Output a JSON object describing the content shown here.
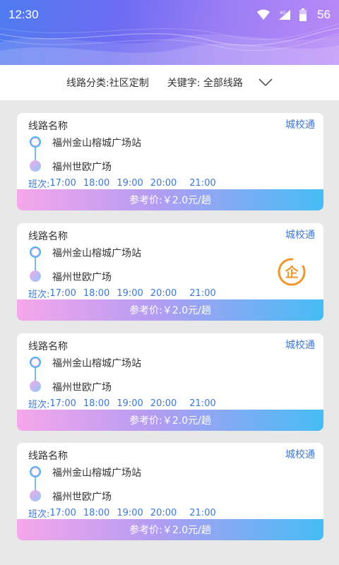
{
  "status_bar": {
    "time": "12:30",
    "battery": "56",
    "icons": [
      "wifi-icon",
      "signal-4g-icon",
      "battery-icon"
    ]
  },
  "filter": {
    "category_label": "线路分类:社区定制",
    "keyword_label": "关键字: 全部线路",
    "dropdown_icon": "chevron-down-icon"
  },
  "colors": {
    "accent_blue": "#3c78d8",
    "badge_orange": "#f0962a",
    "price_gradient_start": "#f6a7ea",
    "price_gradient_end": "#45bdf5"
  },
  "routes": [
    {
      "name": "线路名称",
      "tag": "城校通",
      "start": "福州金山榕城广场站",
      "end": "福州世欧广场",
      "schedule_label": "班次:",
      "times": [
        "17:00",
        "18:00",
        "19:00",
        "20:00",
        "21:00"
      ],
      "price": "参考价:￥2.0元/趟",
      "enterprise": false
    },
    {
      "name": "线路名称",
      "tag": "城校通",
      "start": "福州金山榕城广场站",
      "end": "福州世欧广场",
      "schedule_label": "班次:",
      "times": [
        "17:00",
        "18:00",
        "19:00",
        "20:00",
        "21:00"
      ],
      "price": "参考价:￥2.0元/趟",
      "enterprise": true,
      "enterprise_label": "企"
    },
    {
      "name": "线路名称",
      "tag": "城校通",
      "start": "福州金山榕城广场站",
      "end": "福州世欧广场",
      "schedule_label": "班次:",
      "times": [
        "17:00",
        "18:00",
        "19:00",
        "20:00",
        "21:00"
      ],
      "price": "参考价:￥2.0元/趟",
      "enterprise": false
    },
    {
      "name": "线路名称",
      "tag": "城校通",
      "start": "福州金山榕城广场站",
      "end": "福州世欧广场",
      "schedule_label": "班次:",
      "times": [
        "17:00",
        "18:00",
        "19:00",
        "20:00",
        "21:00"
      ],
      "price": "参考价:￥2.0元/趟",
      "enterprise": false
    }
  ]
}
